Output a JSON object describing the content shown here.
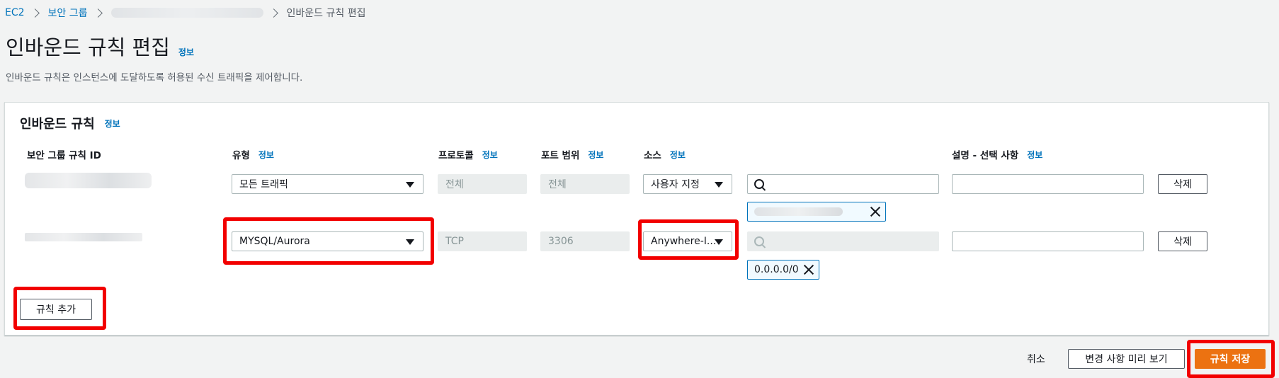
{
  "breadcrumb": {
    "items": [
      "EC2",
      "보안 그룹",
      "인바운드 규칙 편집"
    ]
  },
  "header": {
    "title": "인바운드 규칙 편집",
    "info": "정보",
    "description": "인바운드 규칙은 인스턴스에 도달하도록 허용된 수신 트래픽을 제어합니다."
  },
  "panel": {
    "title": "인바운드 규칙",
    "info": "정보",
    "columns": {
      "rule_id": "보안 그룹 규칙 ID",
      "type": "유형",
      "protocol": "프로토콜",
      "port": "포트 범위",
      "source": "소스",
      "description": "설명 - 선택 사항",
      "info": "정보"
    },
    "rows": [
      {
        "type": "모든 트래픽",
        "protocol": "전체",
        "port": "전체",
        "source": "사용자 지정",
        "search_value": "",
        "token": "",
        "description": "",
        "delete": "삭제"
      },
      {
        "type": "MYSQL/Aurora",
        "protocol": "TCP",
        "port": "3306",
        "source": "Anywhere-I...",
        "search_value": "",
        "token": "0.0.0.0/0",
        "description": "",
        "delete": "삭제"
      }
    ],
    "add_rule": "규칙 추가"
  },
  "footer": {
    "cancel": "취소",
    "preview": "변경 사항 미리 보기",
    "save": "규칙 저장"
  },
  "colors": {
    "accent": "#0073bb",
    "primary": "#ec7211",
    "highlight": "#f20000"
  }
}
